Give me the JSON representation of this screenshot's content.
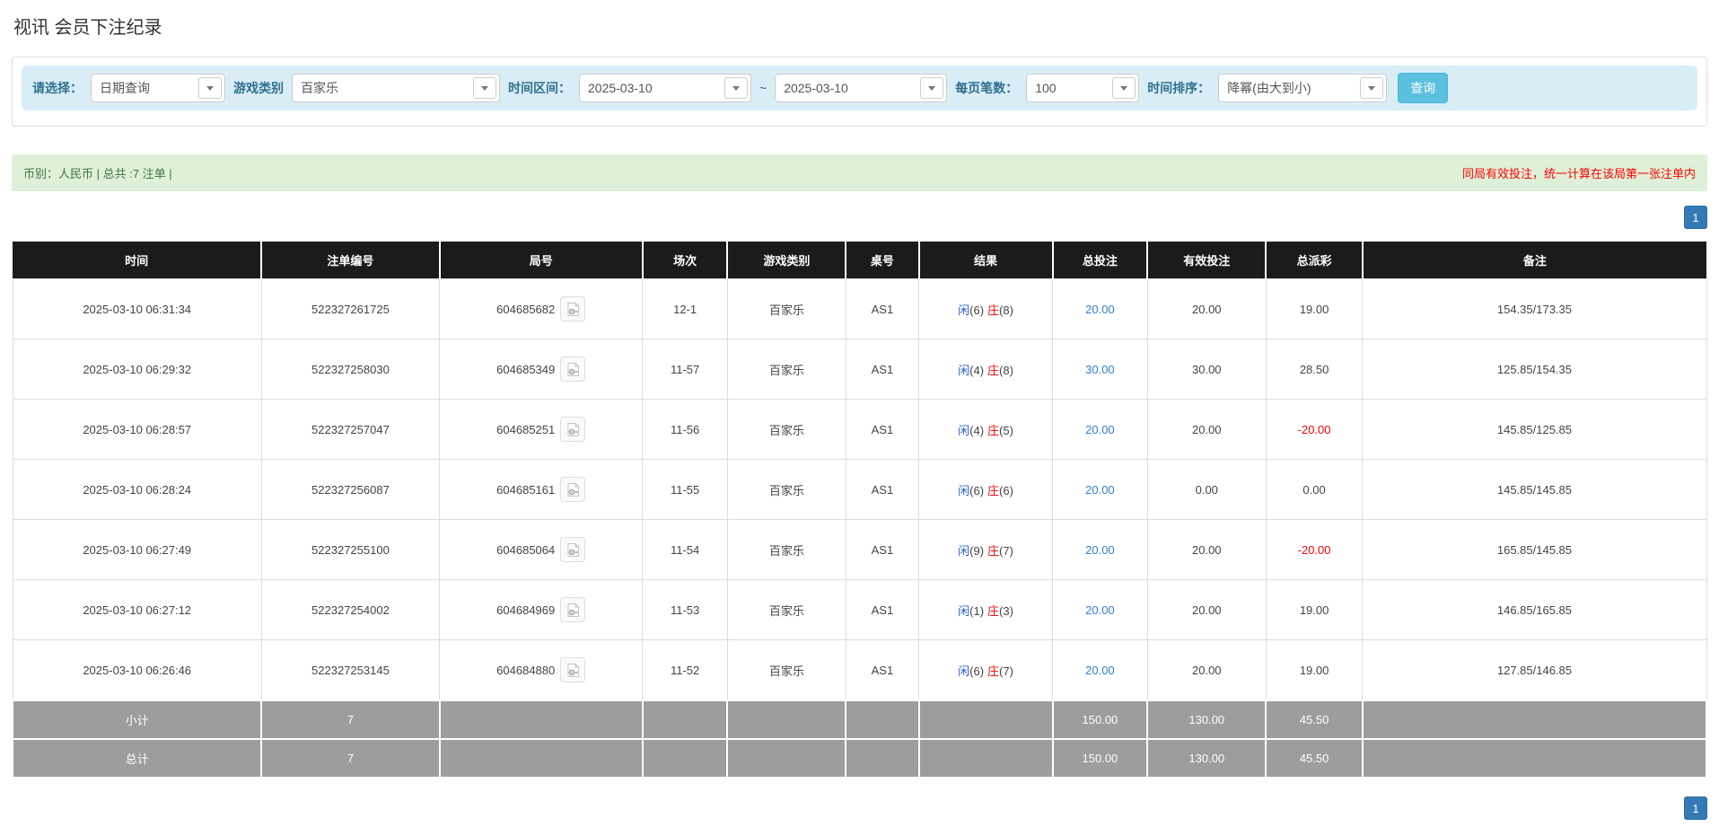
{
  "page": {
    "title": "视讯 会员下注纪录"
  },
  "filters": {
    "select_label": "请选择：",
    "select_value": "日期查询",
    "game_type_label": "游戏类别",
    "game_type_value": "百家乐",
    "date_range_label": "时间区间：",
    "date_from": "2025-03-10",
    "date_separator": "~",
    "date_to": "2025-03-10",
    "page_size_label": "每页笔数：",
    "page_size_value": "100",
    "sort_label": "时间排序：",
    "sort_value": "降幂(由大到小)",
    "search_button": "查询"
  },
  "summary": {
    "left": "币别：人民币 | 总共 :7 注单 |",
    "right": "同局有效投注，统一计算在该局第一张注单内"
  },
  "pagination": {
    "page": "1"
  },
  "icons": {
    "video": "video-icon",
    "dropdown": "chevron-down-icon"
  },
  "colors": {
    "accent_blue": "#337ab7",
    "link_blue": "#2e7fd9",
    "player_blue": "#2d5fd0",
    "banker_red": "#ee1111",
    "negative_red": "#ff0000",
    "header_bg": "#1b1b1b",
    "footer_bg": "#9d9d9d",
    "filter_bg": "#d9edf7",
    "summary_bg": "#dff0d8",
    "search_btn": "#5bc0de"
  },
  "table": {
    "headers": [
      "时间",
      "注单编号",
      "局号",
      "场次",
      "游戏类别",
      "桌号",
      "结果",
      "总投注",
      "有效投注",
      "总派彩",
      "备注"
    ],
    "rows": [
      {
        "time": "2025-03-10 06:31:34",
        "bet_no": "522327261725",
        "round_no": "604685682",
        "session": "12-1",
        "game": "百家乐",
        "table": "AS1",
        "player": "闲",
        "player_score": "(6)",
        "banker": "庄",
        "banker_score": "(8)",
        "total_bet": "20.00",
        "valid_bet": "20.00",
        "payout": "19.00",
        "note": "154.35/173.35"
      },
      {
        "time": "2025-03-10 06:29:32",
        "bet_no": "522327258030",
        "round_no": "604685349",
        "session": "11-57",
        "game": "百家乐",
        "table": "AS1",
        "player": "闲",
        "player_score": "(4)",
        "banker": "庄",
        "banker_score": "(8)",
        "total_bet": "30.00",
        "valid_bet": "30.00",
        "payout": "28.50",
        "note": "125.85/154.35"
      },
      {
        "time": "2025-03-10 06:28:57",
        "bet_no": "522327257047",
        "round_no": "604685251",
        "session": "11-56",
        "game": "百家乐",
        "table": "AS1",
        "player": "闲",
        "player_score": "(4)",
        "banker": "庄",
        "banker_score": "(5)",
        "total_bet": "20.00",
        "valid_bet": "20.00",
        "payout": "-20.00",
        "note": "145.85/125.85"
      },
      {
        "time": "2025-03-10 06:28:24",
        "bet_no": "522327256087",
        "round_no": "604685161",
        "session": "11-55",
        "game": "百家乐",
        "table": "AS1",
        "player": "闲",
        "player_score": "(6)",
        "banker": "庄",
        "banker_score": "(6)",
        "total_bet": "20.00",
        "valid_bet": "0.00",
        "payout": "0.00",
        "note": "145.85/145.85"
      },
      {
        "time": "2025-03-10 06:27:49",
        "bet_no": "522327255100",
        "round_no": "604685064",
        "session": "11-54",
        "game": "百家乐",
        "table": "AS1",
        "player": "闲",
        "player_score": "(9)",
        "banker": "庄",
        "banker_score": "(7)",
        "total_bet": "20.00",
        "valid_bet": "20.00",
        "payout": "-20.00",
        "note": "165.85/145.85"
      },
      {
        "time": "2025-03-10 06:27:12",
        "bet_no": "522327254002",
        "round_no": "604684969",
        "session": "11-53",
        "game": "百家乐",
        "table": "AS1",
        "player": "闲",
        "player_score": "(1)",
        "banker": "庄",
        "banker_score": "(3)",
        "total_bet": "20.00",
        "valid_bet": "20.00",
        "payout": "19.00",
        "note": "146.85/165.85"
      },
      {
        "time": "2025-03-10 06:26:46",
        "bet_no": "522327253145",
        "round_no": "604684880",
        "session": "11-52",
        "game": "百家乐",
        "table": "AS1",
        "player": "闲",
        "player_score": "(6)",
        "banker": "庄",
        "banker_score": "(7)",
        "total_bet": "20.00",
        "valid_bet": "20.00",
        "payout": "19.00",
        "note": "127.85/146.85"
      }
    ],
    "subtotal": {
      "label": "小计",
      "count": "7",
      "total_bet": "150.00",
      "valid_bet": "130.00",
      "payout": "45.50"
    },
    "total": {
      "label": "总计",
      "count": "7",
      "total_bet": "150.00",
      "valid_bet": "130.00",
      "payout": "45.50"
    }
  }
}
